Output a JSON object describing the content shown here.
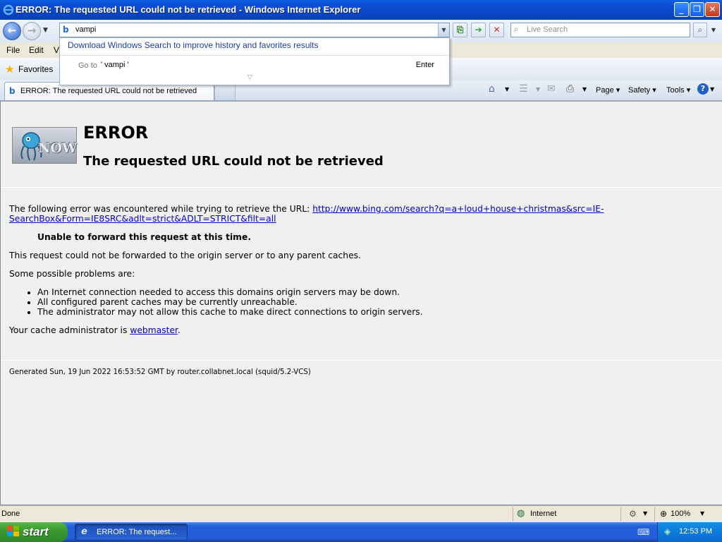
{
  "window": {
    "title": "ERROR: The requested URL could not be retrieved - Windows Internet Explorer"
  },
  "address": {
    "value": "vampi"
  },
  "search": {
    "placeholder": "Live Search"
  },
  "menu": {
    "items": [
      "File",
      "Edit",
      "Vi"
    ]
  },
  "favorites": {
    "label": "Favorites"
  },
  "tab": {
    "title": "ERROR: The requested URL could not be retrieved"
  },
  "commandbar": {
    "page": "Page ▾",
    "safety": "Safety ▾",
    "tools": "Tools ▾"
  },
  "autocomplete": {
    "download_text": "Download Windows Search to improve history and favorites results",
    "goto_prefix": "Go to",
    "goto_value": "' vampi '",
    "enter": "Enter"
  },
  "page": {
    "logo_text": "NOW",
    "heading": "ERROR",
    "subheading": "The requested URL could not be retrieved",
    "intro": "The following error was encountered while trying to retrieve the URL:",
    "url_line1": "http://www.bing.com/search?q=a+loud+house+christmas&src=IE-",
    "url_line2": "SearchBox&Form=IE8SRC&adlt=strict&ADLT=STRICT&filt=all",
    "reason": "Unable to forward this request at this time.",
    "explanation": "This request could not be forwarded to the origin server or to any parent caches.",
    "problems_intro": "Some possible problems are:",
    "problems": [
      "An Internet connection needed to access this domains origin servers may be down.",
      "All configured parent caches may be currently unreachable.",
      "The administrator may not allow this cache to make direct connections to origin servers."
    ],
    "admin_prefix": "Your cache administrator is",
    "admin_link": "webmaster",
    "admin_suffix": ".",
    "footer": "Generated Sun, 19 Jun 2022 16:53:52 GMT by router.collabnet.local (squid/5.2-VCS)"
  },
  "status": {
    "left": "Done",
    "zone": "Internet",
    "zoom": "100%"
  },
  "taskbar": {
    "start": "start",
    "task": "ERROR: The request...",
    "clock": "12:53 PM"
  },
  "colors": {
    "titlebar": "#0a5fe0",
    "link": "#0000cc",
    "taskbar": "#245edb",
    "start": "#3c9a31"
  }
}
